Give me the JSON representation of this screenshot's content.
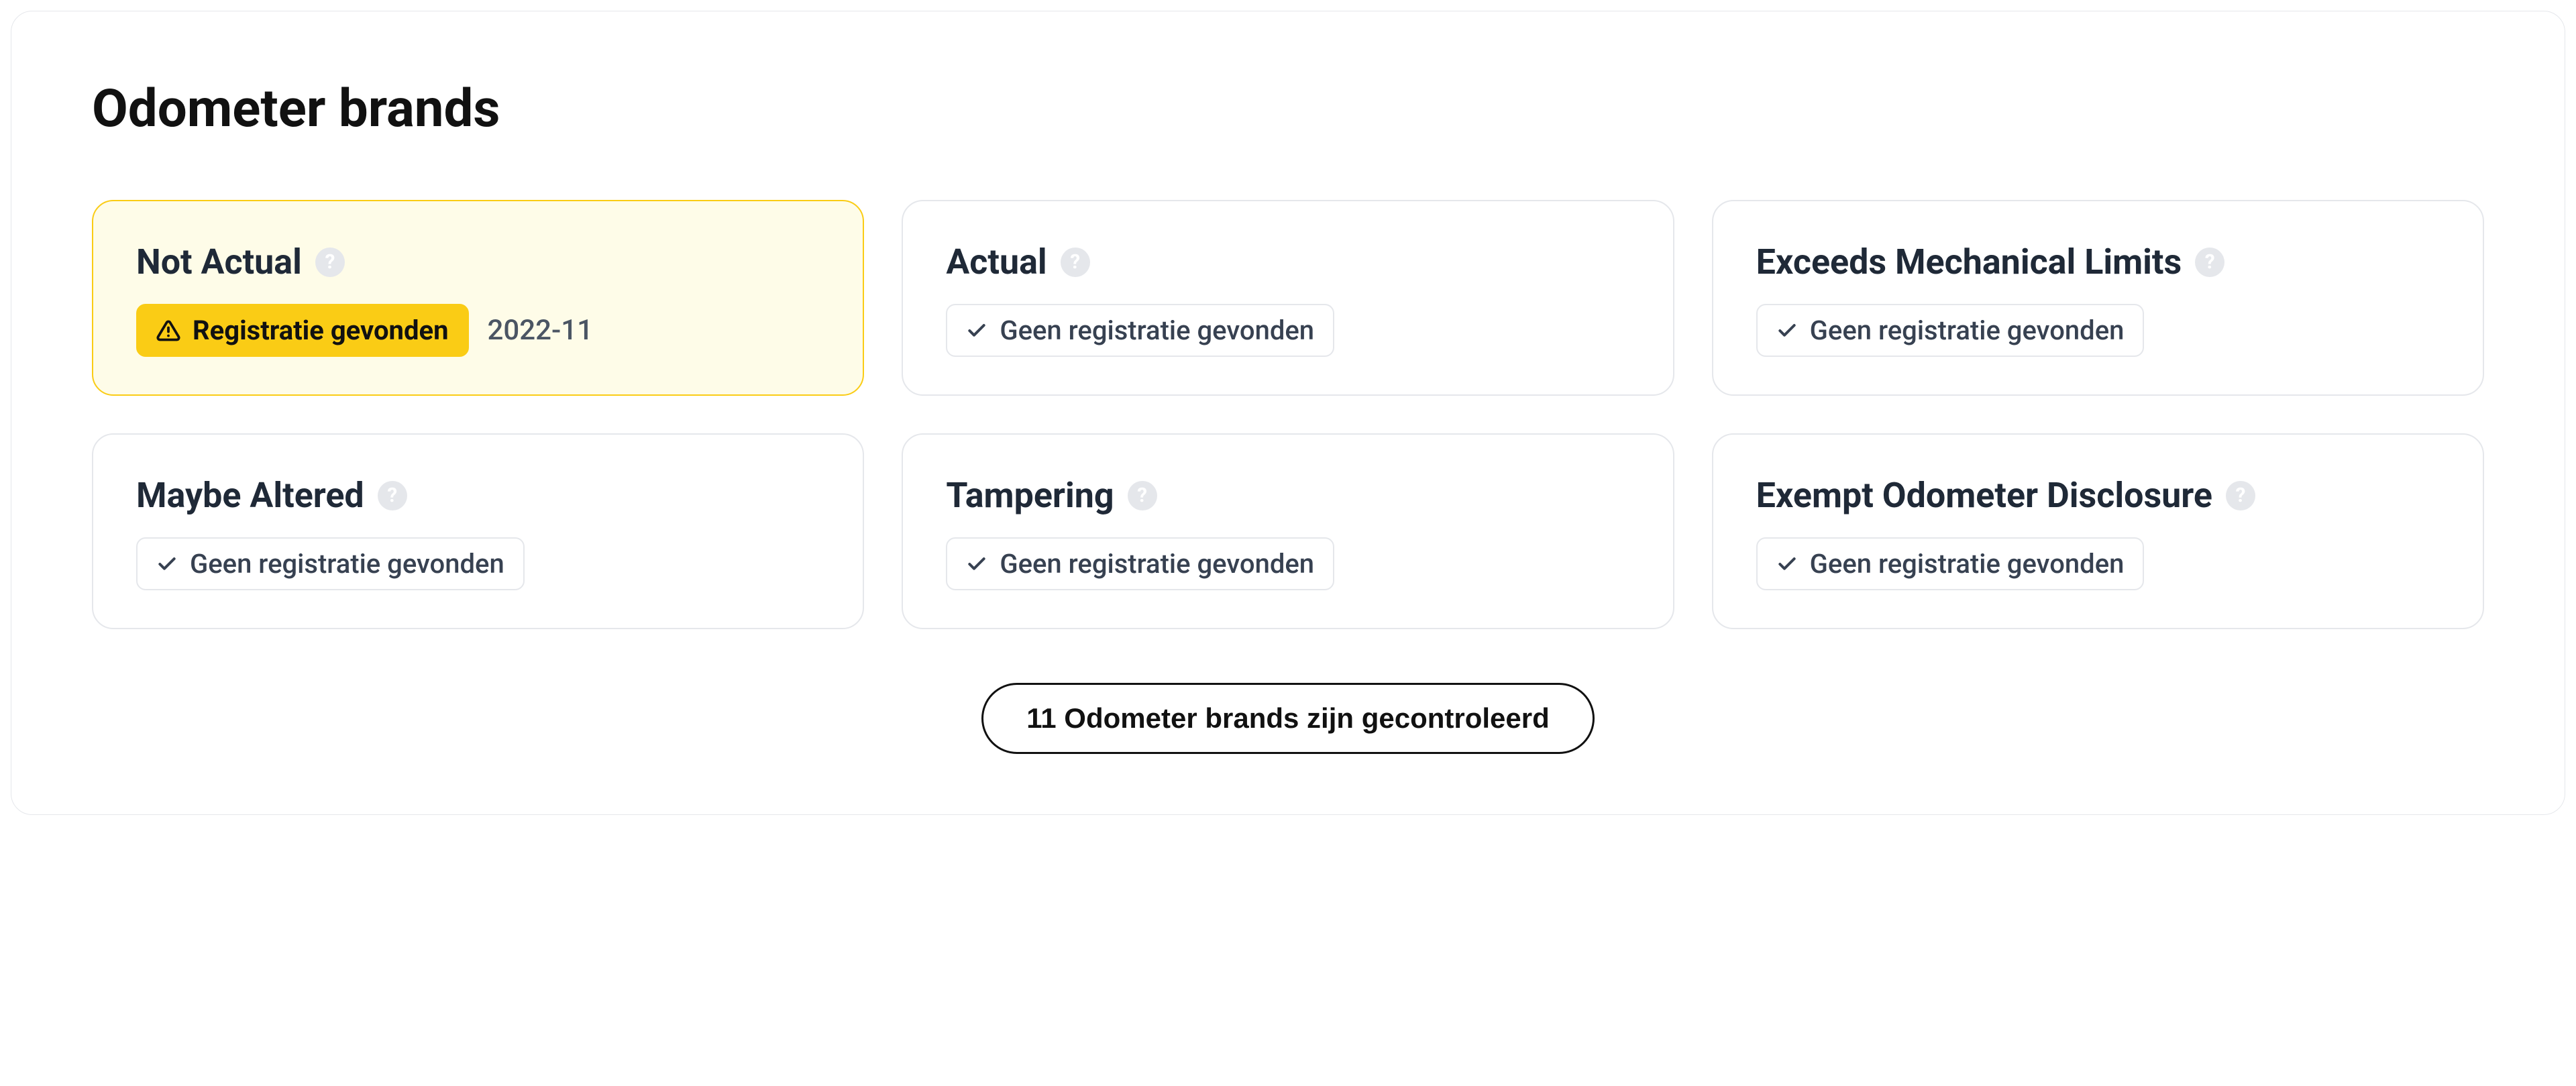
{
  "section": {
    "title": "Odometer brands"
  },
  "cards": [
    {
      "title": "Not Actual",
      "status_label": "Registratie gevonden",
      "date": "2022-11",
      "highlight": true
    },
    {
      "title": "Actual",
      "status_label": "Geen registratie gevonden",
      "date": "",
      "highlight": false
    },
    {
      "title": "Exceeds Mechanical Limits",
      "status_label": "Geen registratie gevonden",
      "date": "",
      "highlight": false
    },
    {
      "title": "Maybe Altered",
      "status_label": "Geen registratie gevonden",
      "date": "",
      "highlight": false
    },
    {
      "title": "Tampering",
      "status_label": "Geen registratie gevonden",
      "date": "",
      "highlight": false
    },
    {
      "title": "Exempt Odometer Disclosure",
      "status_label": "Geen registratie gevonden",
      "date": "",
      "highlight": false
    }
  ],
  "footer": {
    "summary": "11 Odometer brands zijn gecontroleerd"
  }
}
